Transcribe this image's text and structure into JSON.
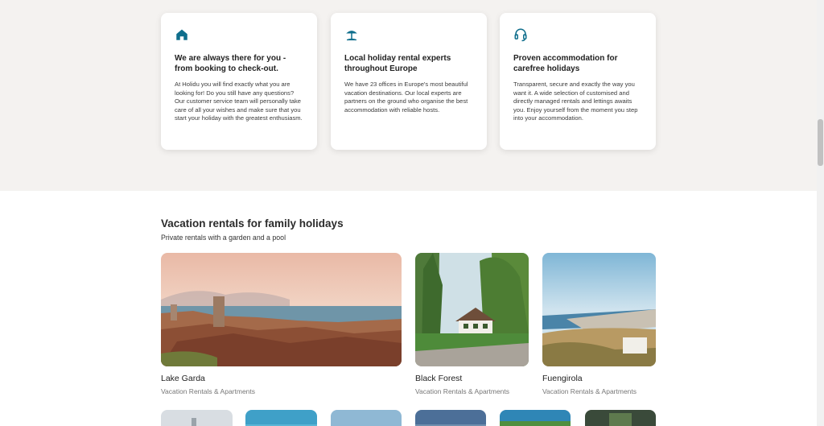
{
  "features": [
    {
      "icon": "house-icon",
      "title": "We are always there for you - from booking to check-out.",
      "body": "At Holidu you will find exactly what you are looking for! Do you still have any questions? Our customer service team will personally take care of all your wishes and make sure that you start your holiday with the greatest enthusiasm."
    },
    {
      "icon": "beach-umbrella-icon",
      "title": "Local holiday rental experts throughout Europe",
      "body": "We have 23 offices in Europe's most beautiful vacation destinations. Our local experts are partners on the ground who organise the best accommodation with reliable hosts."
    },
    {
      "icon": "headset-icon",
      "title": "Proven accommodation for carefree holidays",
      "body": "Transparent, secure and exactly the way you want it. A wide selection of customised and directly managed rentals and lettings awaits you. Enjoy yourself from the moment you step into your accommodation."
    }
  ],
  "family_section": {
    "title": "Vacation rentals for family holidays",
    "subtitle": "Private rentals with a garden and a pool",
    "destinations": [
      {
        "name": "Lake Garda",
        "subtitle": "Vacation Rentals & Apartments"
      },
      {
        "name": "Black Forest",
        "subtitle": "Vacation Rentals & Apartments"
      },
      {
        "name": "Fuengirola",
        "subtitle": "Vacation Rentals & Apartments"
      }
    ]
  },
  "colors": {
    "icon_teal": "#0f6e8c",
    "band_bg": "#f4f2f0"
  }
}
